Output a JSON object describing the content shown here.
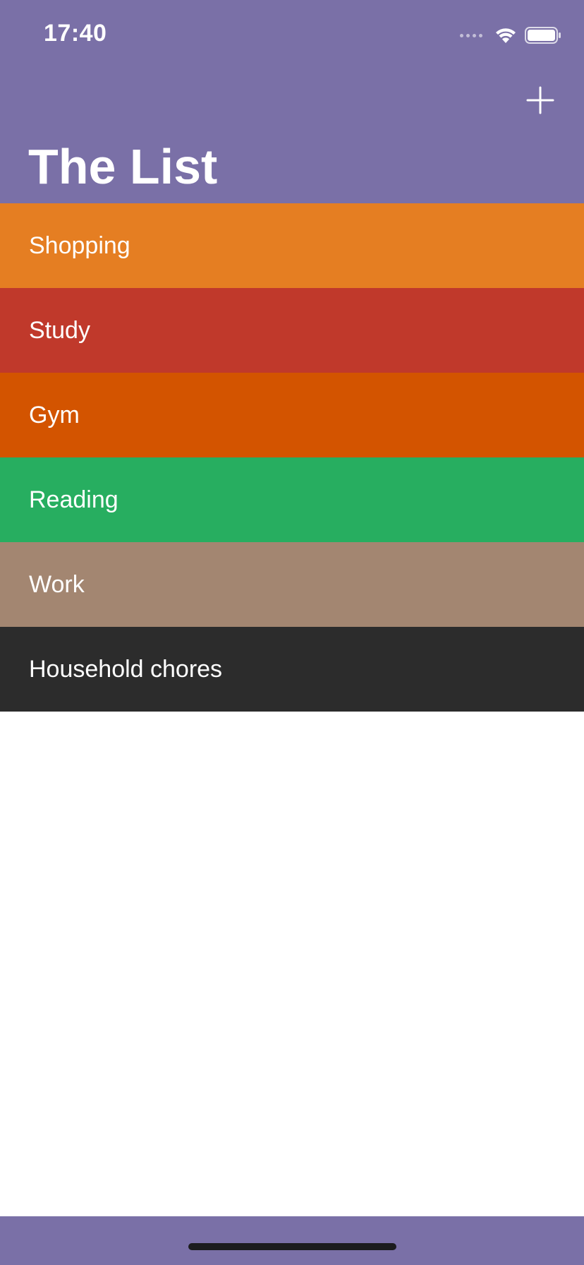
{
  "status_bar": {
    "time": "17:40",
    "signal_icon": "signal-dots-icon",
    "wifi_icon": "wifi-icon",
    "battery_icon": "battery-icon"
  },
  "nav": {
    "title": "The List",
    "add_icon": "plus-icon",
    "background_color": "#7a70a7"
  },
  "list": {
    "items": [
      {
        "label": "Shopping",
        "color": "#e57e22"
      },
      {
        "label": "Study",
        "color": "#c0392b"
      },
      {
        "label": "Gym",
        "color": "#d35400"
      },
      {
        "label": "Reading",
        "color": "#27ae60"
      },
      {
        "label": "Work",
        "color": "#a38671"
      },
      {
        "label": "Household chores",
        "color": "#2c2c2c"
      }
    ]
  }
}
